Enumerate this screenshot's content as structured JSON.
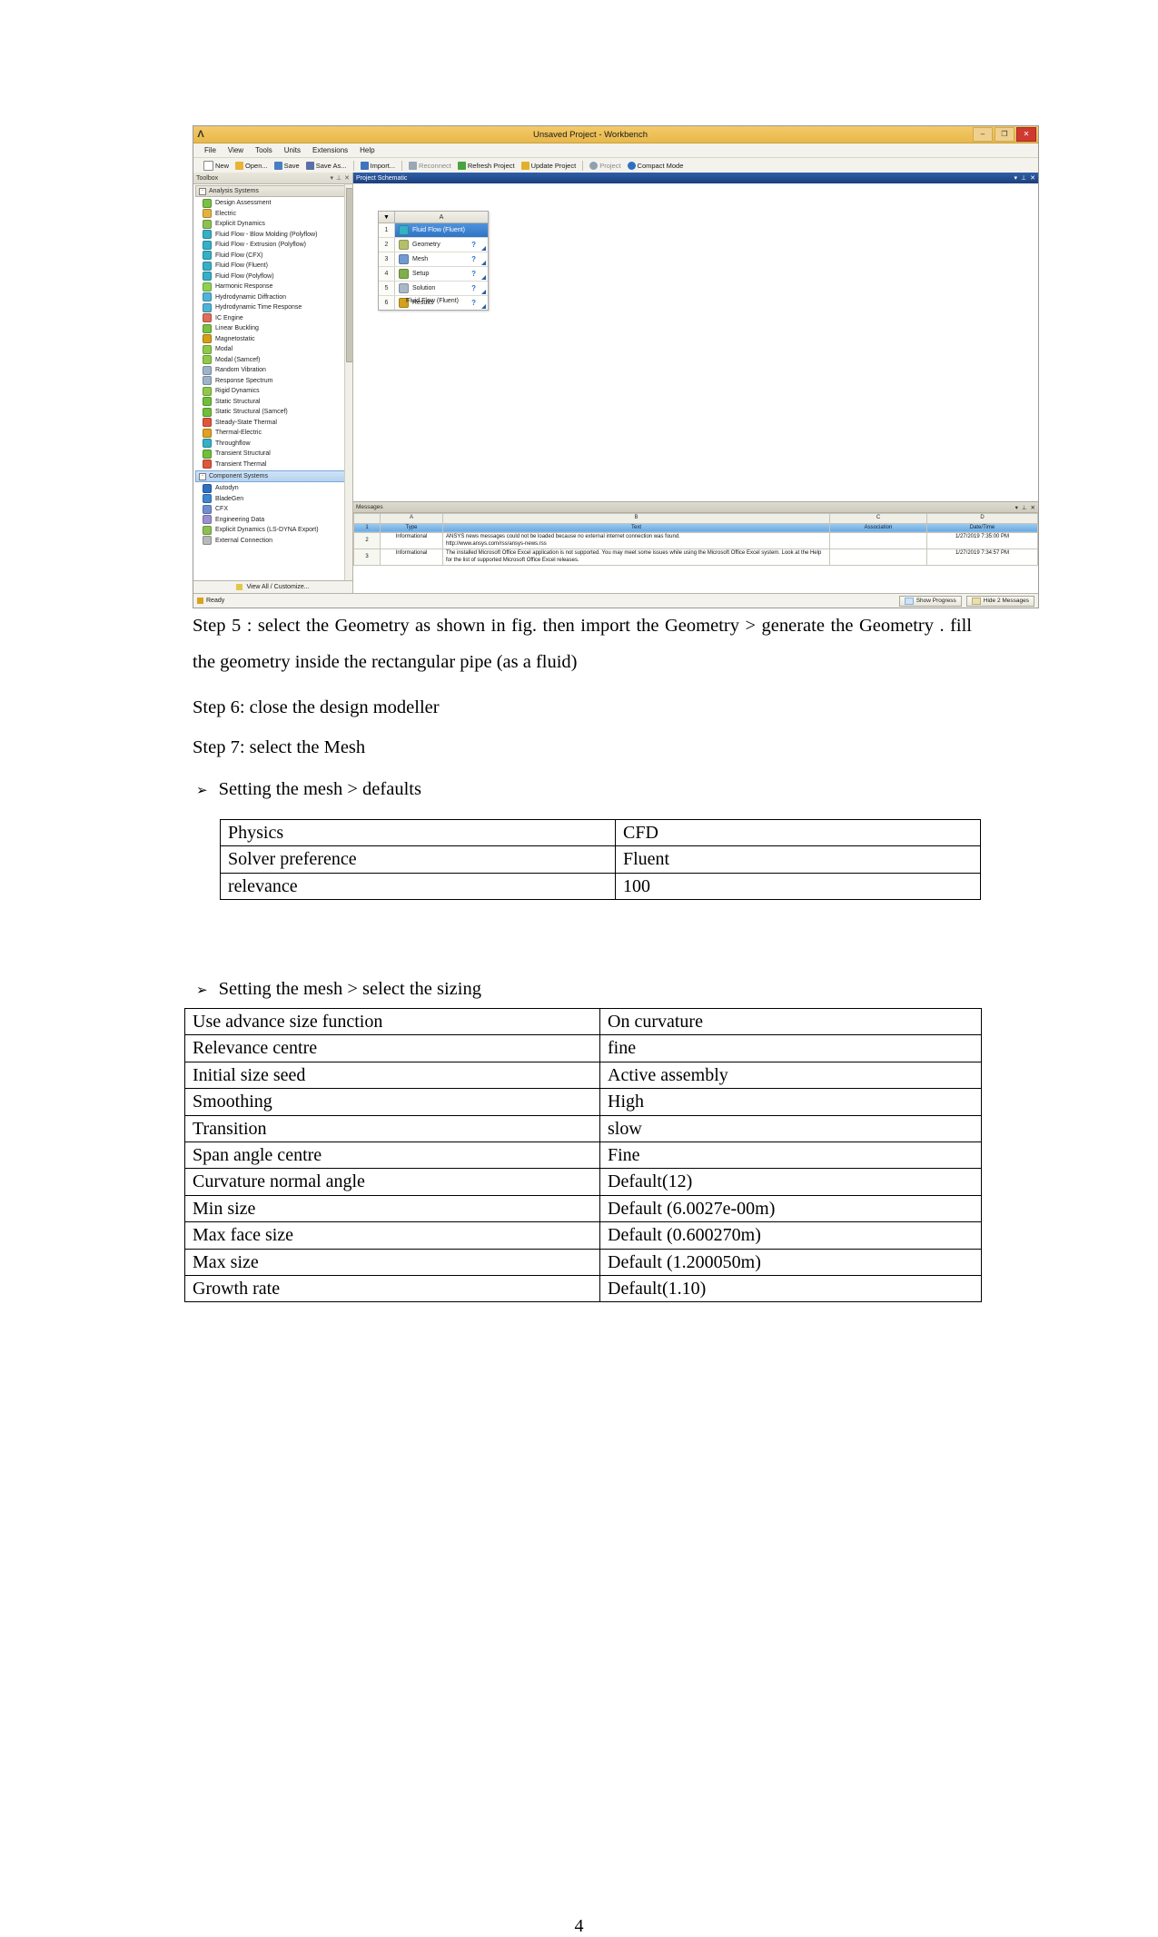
{
  "screenshot": {
    "titlebar": {
      "logo": "ansys-logo",
      "title": "Unsaved Project - Workbench",
      "minimize": "–",
      "restore": "❐",
      "close": "✕"
    },
    "menu": [
      "File",
      "View",
      "Tools",
      "Units",
      "Extensions",
      "Help"
    ],
    "toolbar": [
      {
        "label": "New",
        "icon": "new-document-icon",
        "color": "#ffffff"
      },
      {
        "label": "Open...",
        "icon": "open-folder-icon",
        "color": "#e8b437"
      },
      {
        "label": "Save",
        "icon": "save-disk-icon",
        "color": "#4a7ec4"
      },
      {
        "label": "Save As...",
        "icon": "save-as-icon",
        "color": "#5a6fa8"
      },
      {
        "label": "Import...",
        "icon": "import-icon",
        "color": "#3f74bd"
      },
      {
        "label": "Reconnect",
        "icon": "reconnect-icon",
        "color": "#9aa7b5"
      },
      {
        "label": "Refresh Project",
        "icon": "refresh-icon",
        "color": "#4aa33e"
      },
      {
        "label": "Update Project",
        "icon": "update-lightning-icon",
        "color": "#e3b02a"
      },
      {
        "label": "Project",
        "icon": "project-icon",
        "color": "#8fa0b0"
      },
      {
        "label": "Compact Mode",
        "icon": "compact-mode-icon",
        "color": "#2f6fc0"
      }
    ],
    "toolbox": {
      "panel_title": "Toolbox",
      "pin": "⊥",
      "collapse": "▾",
      "close": "✕",
      "groups": [
        {
          "name": "Analysis Systems",
          "expander": "⊟",
          "selected": false,
          "items": [
            {
              "label": "Design Assessment",
              "icon": "design-assessment-icon",
              "color": "#7ac143"
            },
            {
              "label": "Electric",
              "icon": "electric-icon",
              "color": "#e3b23c"
            },
            {
              "label": "Explicit Dynamics",
              "icon": "explicit-dynamics-icon",
              "color": "#8cc152"
            },
            {
              "label": "Fluid Flow - Blow Molding (Polyflow)",
              "icon": "fluid-flow-icon",
              "color": "#35b0c6"
            },
            {
              "label": "Fluid Flow - Extrusion (Polyflow)",
              "icon": "fluid-flow-icon",
              "color": "#35b0c6"
            },
            {
              "label": "Fluid Flow (CFX)",
              "icon": "fluid-flow-icon",
              "color": "#35b0c6"
            },
            {
              "label": "Fluid Flow (Fluent)",
              "icon": "fluid-flow-icon",
              "color": "#35b0c6"
            },
            {
              "label": "Fluid Flow (Polyflow)",
              "icon": "fluid-flow-icon",
              "color": "#35b0c6"
            },
            {
              "label": "Harmonic Response",
              "icon": "harmonic-response-icon",
              "color": "#8fd14f"
            },
            {
              "label": "Hydrodynamic Diffraction",
              "icon": "hydrodynamic-diffraction-icon",
              "color": "#4fb3d9"
            },
            {
              "label": "Hydrodynamic Time Response",
              "icon": "hydrodynamic-time-icon",
              "color": "#4fb3d9"
            },
            {
              "label": "IC Engine",
              "icon": "ic-engine-icon",
              "color": "#e06c5a"
            },
            {
              "label": "Linear Buckling",
              "icon": "linear-buckling-icon",
              "color": "#7ac143"
            },
            {
              "label": "Magnetostatic",
              "icon": "magnetostatic-icon",
              "color": "#d4a017"
            },
            {
              "label": "Modal",
              "icon": "modal-icon",
              "color": "#8fc94a"
            },
            {
              "label": "Modal (Samcef)",
              "icon": "modal-samcef-icon",
              "color": "#8fc94a"
            },
            {
              "label": "Random Vibration",
              "icon": "random-vibration-icon",
              "color": "#9db4c8"
            },
            {
              "label": "Response Spectrum",
              "icon": "response-spectrum-icon",
              "color": "#9db4c8"
            },
            {
              "label": "Rigid Dynamics",
              "icon": "rigid-dynamics-icon",
              "color": "#8fc94a"
            },
            {
              "label": "Static Structural",
              "icon": "static-structural-icon",
              "color": "#6fbf3a"
            },
            {
              "label": "Static Structural (Samcef)",
              "icon": "static-structural-icon",
              "color": "#6fbf3a"
            },
            {
              "label": "Steady-State Thermal",
              "icon": "steady-state-thermal-icon",
              "color": "#e0563c"
            },
            {
              "label": "Thermal-Electric",
              "icon": "thermal-electric-icon",
              "color": "#e0a020"
            },
            {
              "label": "Throughflow",
              "icon": "throughflow-icon",
              "color": "#35b0c6"
            },
            {
              "label": "Transient Structural",
              "icon": "transient-structural-icon",
              "color": "#6fbf3a"
            },
            {
              "label": "Transient Thermal",
              "icon": "transient-thermal-icon",
              "color": "#e0563c"
            }
          ]
        },
        {
          "name": "Component Systems",
          "expander": "⊟",
          "selected": true,
          "items": [
            {
              "label": "Autodyn",
              "icon": "autodyn-icon",
              "color": "#2f6fc0"
            },
            {
              "label": "BladeGen",
              "icon": "bladegen-icon",
              "color": "#3f86d0"
            },
            {
              "label": "CFX",
              "icon": "cfx-icon",
              "color": "#6f8fd0"
            },
            {
              "label": "Engineering Data",
              "icon": "engineering-data-icon",
              "color": "#9a8fd0"
            },
            {
              "label": "Explicit Dynamics (LS-DYNA Export)",
              "icon": "explicit-dynamics-lsdyna-icon",
              "color": "#8cc152"
            },
            {
              "label": "External Connection",
              "icon": "external-connection-gear-icon",
              "color": "#b8b8b8"
            }
          ]
        }
      ],
      "footer": {
        "label": "View All / Customize...",
        "icon": "funnel-icon"
      }
    },
    "project_schematic": {
      "panel_title": "Project Schematic",
      "collapse": "▾",
      "pin": "⊥",
      "close": "✕",
      "column_header": "A",
      "filter_icon": "filter-arrow-icon",
      "caption": "Fluid Flow (Fluent)",
      "rows": [
        {
          "n": "1",
          "label": "Fluid Flow (Fluent)",
          "icon": "fluid-flow-fluent-icon",
          "color": "#35b0c6",
          "selected": true,
          "status": ""
        },
        {
          "n": "2",
          "label": "Geometry",
          "icon": "geometry-icon",
          "color": "#b5bf6a",
          "selected": false,
          "status": "?"
        },
        {
          "n": "3",
          "label": "Mesh",
          "icon": "mesh-icon",
          "color": "#6f9bd1",
          "selected": false,
          "status": "?"
        },
        {
          "n": "4",
          "label": "Setup",
          "icon": "setup-icon",
          "color": "#7fae4a",
          "selected": false,
          "status": "?"
        },
        {
          "n": "5",
          "label": "Solution",
          "icon": "solution-icon",
          "color": "#a9b8c6",
          "selected": false,
          "status": "?"
        },
        {
          "n": "6",
          "label": "Results",
          "icon": "results-icon",
          "color": "#d2a11d",
          "selected": false,
          "status": "?"
        }
      ]
    },
    "messages": {
      "panel_title": "Messages",
      "collapse": "▾",
      "pin": "⊥",
      "close": "✕",
      "column_letters": [
        "",
        "A",
        "B",
        "C",
        "D"
      ],
      "field_headers": [
        "1",
        "Type",
        "Text",
        "Association",
        "Date/Time"
      ],
      "rows": [
        {
          "n": "2",
          "type": "Informational",
          "text": "ANSYS news messages could not be loaded because no external internet connection was found.\nhttp://www.ansys.com/rss/ansys-news.rss",
          "association": "",
          "datetime": "1/27/2019 7:35:00 PM"
        },
        {
          "n": "3",
          "type": "Informational",
          "text": "The installed Microsoft Office Excel application is not supported. You may meet some issues while using the Microsoft Office Excel system. Look at the Help for the list of supported Microsoft Office Excel releases.",
          "association": "",
          "datetime": "1/27/2019 7:34:57 PM"
        }
      ]
    },
    "statusbar": {
      "ready": "Ready",
      "ready_icon": "status-lock-icon",
      "show_progress": "Show Progress",
      "show_progress_icon": "progress-icon",
      "hide_messages": "Hide 2 Messages",
      "hide_messages_icon": "messages-icon"
    }
  },
  "document": {
    "step5": "Step 5 : select the Geometry as shown in fig. then import the Geometry > generate the Geometry . fill the geometry inside the rectangular pipe (as a fluid)",
    "step6": "Step 6: close the design modeller",
    "step7": "Step 7: select the Mesh",
    "bullet1": {
      "marker": "➢",
      "text": "Setting the mesh > defaults"
    },
    "bullet2": {
      "marker": "➢",
      "text": "Setting the mesh > select the sizing"
    },
    "table1": [
      {
        "key": "Physics",
        "value": "CFD"
      },
      {
        "key": "Solver preference",
        "value": "Fluent"
      },
      {
        "key": "relevance",
        "value": "100"
      }
    ],
    "table2": [
      {
        "key": "Use advance size function",
        "value": "On curvature"
      },
      {
        "key": "Relevance centre",
        "value": "fine"
      },
      {
        "key": "Initial size seed",
        "value": "Active assembly"
      },
      {
        "key": "Smoothing",
        "value": "High"
      },
      {
        "key": "Transition",
        "value": "slow"
      },
      {
        "key": "Span angle centre",
        "value": "Fine"
      },
      {
        "key": "Curvature normal angle",
        "value": "Default(12)"
      },
      {
        "key": "Min size",
        "value": "Default (6.0027e-00m)"
      },
      {
        "key": "Max face size",
        "value": "Default (0.600270m)"
      },
      {
        "key": "Max size",
        "value": "Default (1.200050m)"
      },
      {
        "key": "Growth rate",
        "value": "Default(1.10)"
      }
    ],
    "page_number": "4"
  }
}
